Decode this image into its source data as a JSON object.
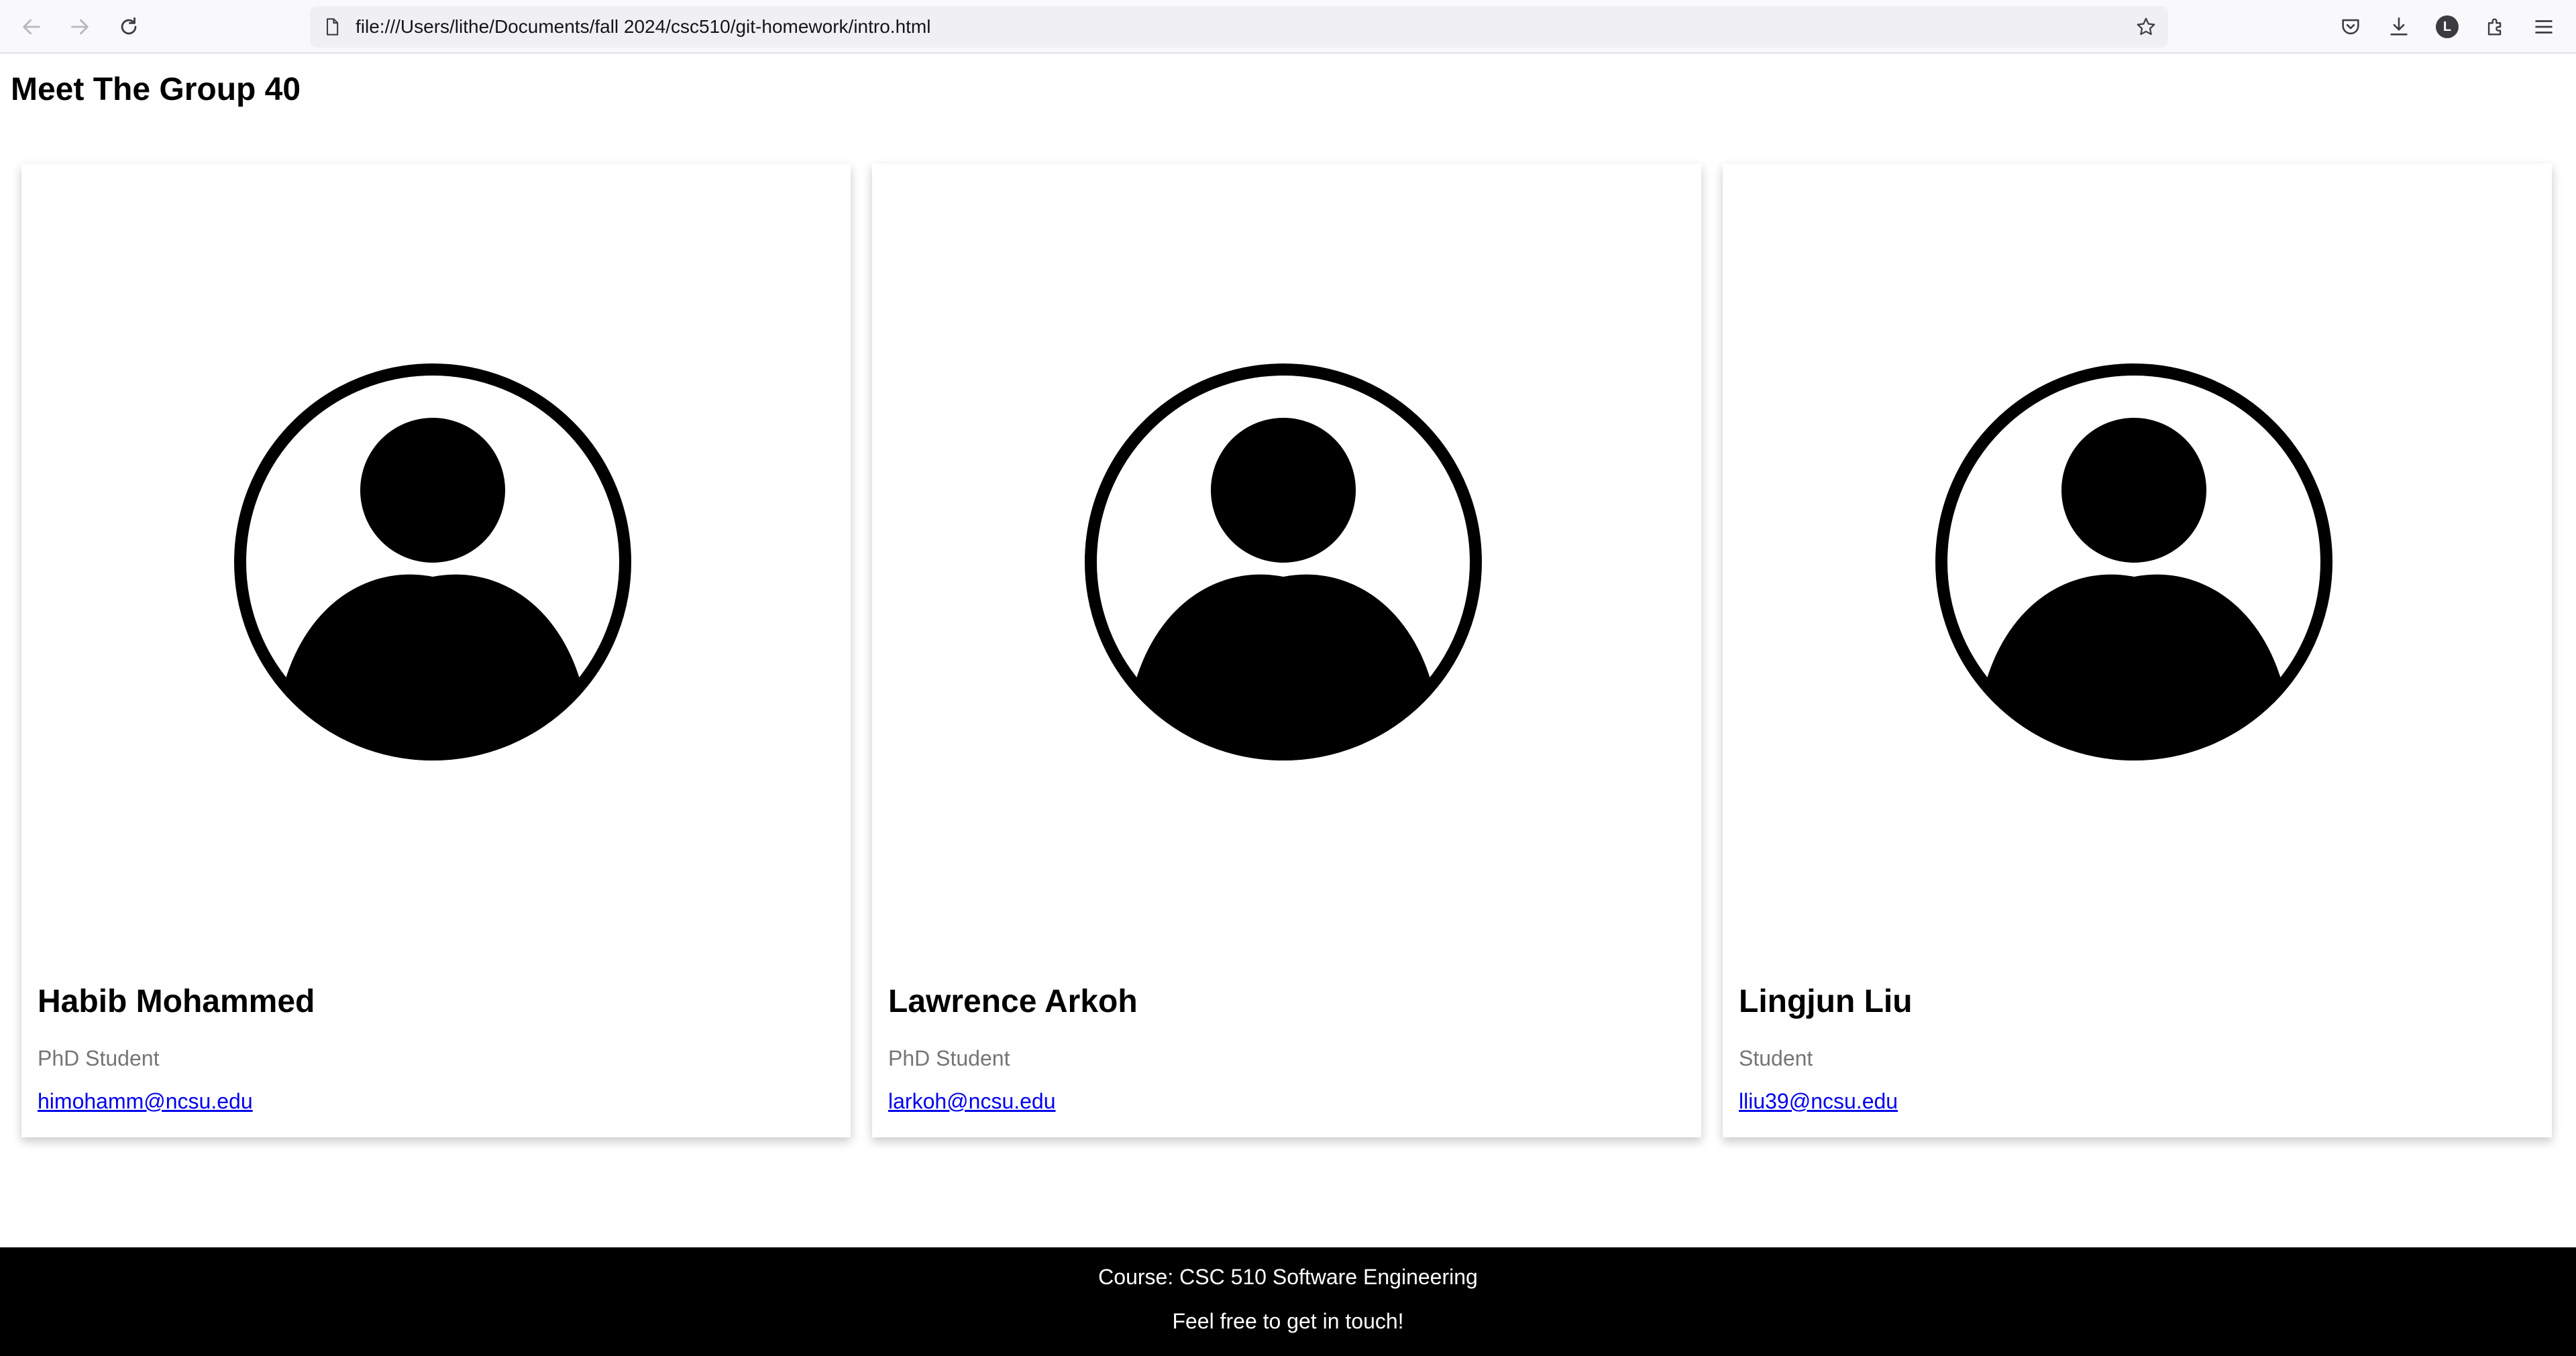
{
  "browser": {
    "url": "file:///Users/lithe/Documents/fall 2024/csc510/git-homework/intro.html",
    "profile_initial": "L"
  },
  "page": {
    "title": "Meet The Group 40"
  },
  "members": [
    {
      "name": "Habib Mohammed",
      "role": "PhD Student",
      "email": "himohamm@ncsu.edu"
    },
    {
      "name": "Lawrence Arkoh",
      "role": "PhD Student",
      "email": "larkoh@ncsu.edu"
    },
    {
      "name": "Lingjun Liu",
      "role": "Student",
      "email": "lliu39@ncsu.edu"
    }
  ],
  "footer": {
    "course": "Course: CSC 510 Software Engineering",
    "contact": "Feel free to get in touch!"
  },
  "colors": {
    "link": "#0000ee",
    "role_text": "#757575",
    "footer_bg": "#000000"
  },
  "icons": {
    "back": "arrow-left",
    "forward": "arrow-right",
    "reload": "reload",
    "page": "document",
    "bookmark": "star",
    "pocket": "pocket",
    "downloads": "download",
    "extensions": "puzzle",
    "menu": "hamburger",
    "member_photo": "user-avatar"
  }
}
